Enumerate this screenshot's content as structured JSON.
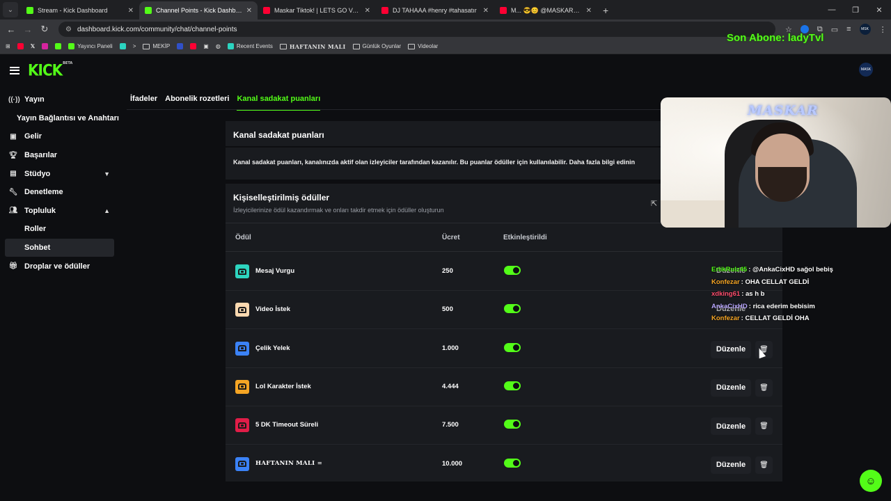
{
  "browser": {
    "tabs": [
      {
        "title": "Stream - Kick Dashboard",
        "favicon": "kick-icon"
      },
      {
        "title": "Channel Points - Kick Dashboard",
        "favicon": "kick-icon",
        "active": true
      },
      {
        "title": "Maskar Tiktok! | LETS GO VAN",
        "favicon": "youtube-icon"
      },
      {
        "title": "DJ TAHAAA #henry #tahasatır",
        "favicon": "youtube-icon"
      },
      {
        "title": "M... 😎😊 @MASKARR #edit",
        "favicon": "youtube-icon"
      }
    ],
    "url": "dashboard.kick.com/community/chat/channel-points",
    "bookmarks": {
      "yayinci_paneli": "Yayıncı Paneli",
      "mekip": "MEKİP",
      "recent_events": "Recent Events",
      "haftanin_mali": "HAFTANIN MALI",
      "gunluk_oyunlar": "Günlük Oyunlar",
      "videolar": "Videolar"
    }
  },
  "overlay": {
    "son_abone": "Son Abone: ladyTvl",
    "cam_label": "MASKAR"
  },
  "header": {
    "logo": "KICK",
    "logo_badge": "BETA",
    "avatar_text": "MASK"
  },
  "sidebar": {
    "items": [
      {
        "label": "Yayın",
        "icon": "broadcast-icon"
      },
      {
        "label": "Yayın Bağlantısı ve Anahtarı"
      },
      {
        "label": "Gelir",
        "icon": "money-icon"
      },
      {
        "label": "Başarılar",
        "icon": "trophy-icon"
      },
      {
        "label": "Stüdyo",
        "icon": "studio-icon"
      },
      {
        "label": "Denetleme",
        "icon": "wrench-icon"
      },
      {
        "label": "Topluluk",
        "icon": "community-icon"
      },
      {
        "label": "Roller"
      },
      {
        "label": "Sohbet"
      },
      {
        "label": "Droplar ve ödüller",
        "icon": "gift-icon"
      }
    ]
  },
  "tabs": {
    "ifadeler": "İfadeler",
    "abonelik": "Abonelik rozetleri",
    "kanal": "Kanal sadakat puanları"
  },
  "panel1": {
    "title": "Kanal sadakat puanları",
    "desc": "Kanal sadakat puanları, kanalınızda aktif olan izleyiciler tarafından kazanılır. Bu puanlar ödüller için kullanılabilir. Daha fazla bilgi edinin"
  },
  "rewards": {
    "title": "Kişiselleştirilmiş ödüller",
    "subtitle": "İzleyicilerinize ödül kazandırmak ve onları takdir etmek için ödüller oluşturun",
    "columns": {
      "reward": "Ödül",
      "cost": "Ücret",
      "enabled": "Etkinleştirildi"
    },
    "edit_label": "Düzenle",
    "rows": [
      {
        "name": "Mesaj Vurgu",
        "cost": "250",
        "color": "#2dd4bf",
        "enabled": true
      },
      {
        "name": "Video İstek",
        "cost": "500",
        "color": "#fcd9b0",
        "enabled": true
      },
      {
        "name": "Çelik Yelek",
        "cost": "1.000",
        "color": "#3b82f6",
        "enabled": true
      },
      {
        "name": "Lol Karakter İstek",
        "cost": "4.444",
        "color": "#f5a524",
        "enabled": true
      },
      {
        "name": "5 DK Timeout Süreli",
        "cost": "7.500",
        "color": "#e11d48",
        "enabled": true
      },
      {
        "name": "HAFTANIN MALI =",
        "cost": "10.000",
        "color": "#3b82f6",
        "enabled": true
      }
    ]
  },
  "chat": [
    {
      "user": "ErlikRulz45",
      "user_color": "#53fc18",
      "text": "@AnkaCixHD sağol bebiş"
    },
    {
      "user": "Konfezar",
      "user_color": "#f5a524",
      "text": "OHA CELLAT GELDİ"
    },
    {
      "user": "xdking61",
      "user_color": "#ff4d6d",
      "text": "as h b"
    },
    {
      "user": "AnkaCixHD",
      "user_color": "#b9a7ff",
      "text": "rica ederim bebisim"
    },
    {
      "user": "Konfezar",
      "user_color": "#f5a524",
      "text": "CELLAT GELDİ OHA"
    }
  ],
  "colors": {
    "accent": "#53fc18",
    "bg": "#0d0e11",
    "panel": "#191b1f"
  }
}
